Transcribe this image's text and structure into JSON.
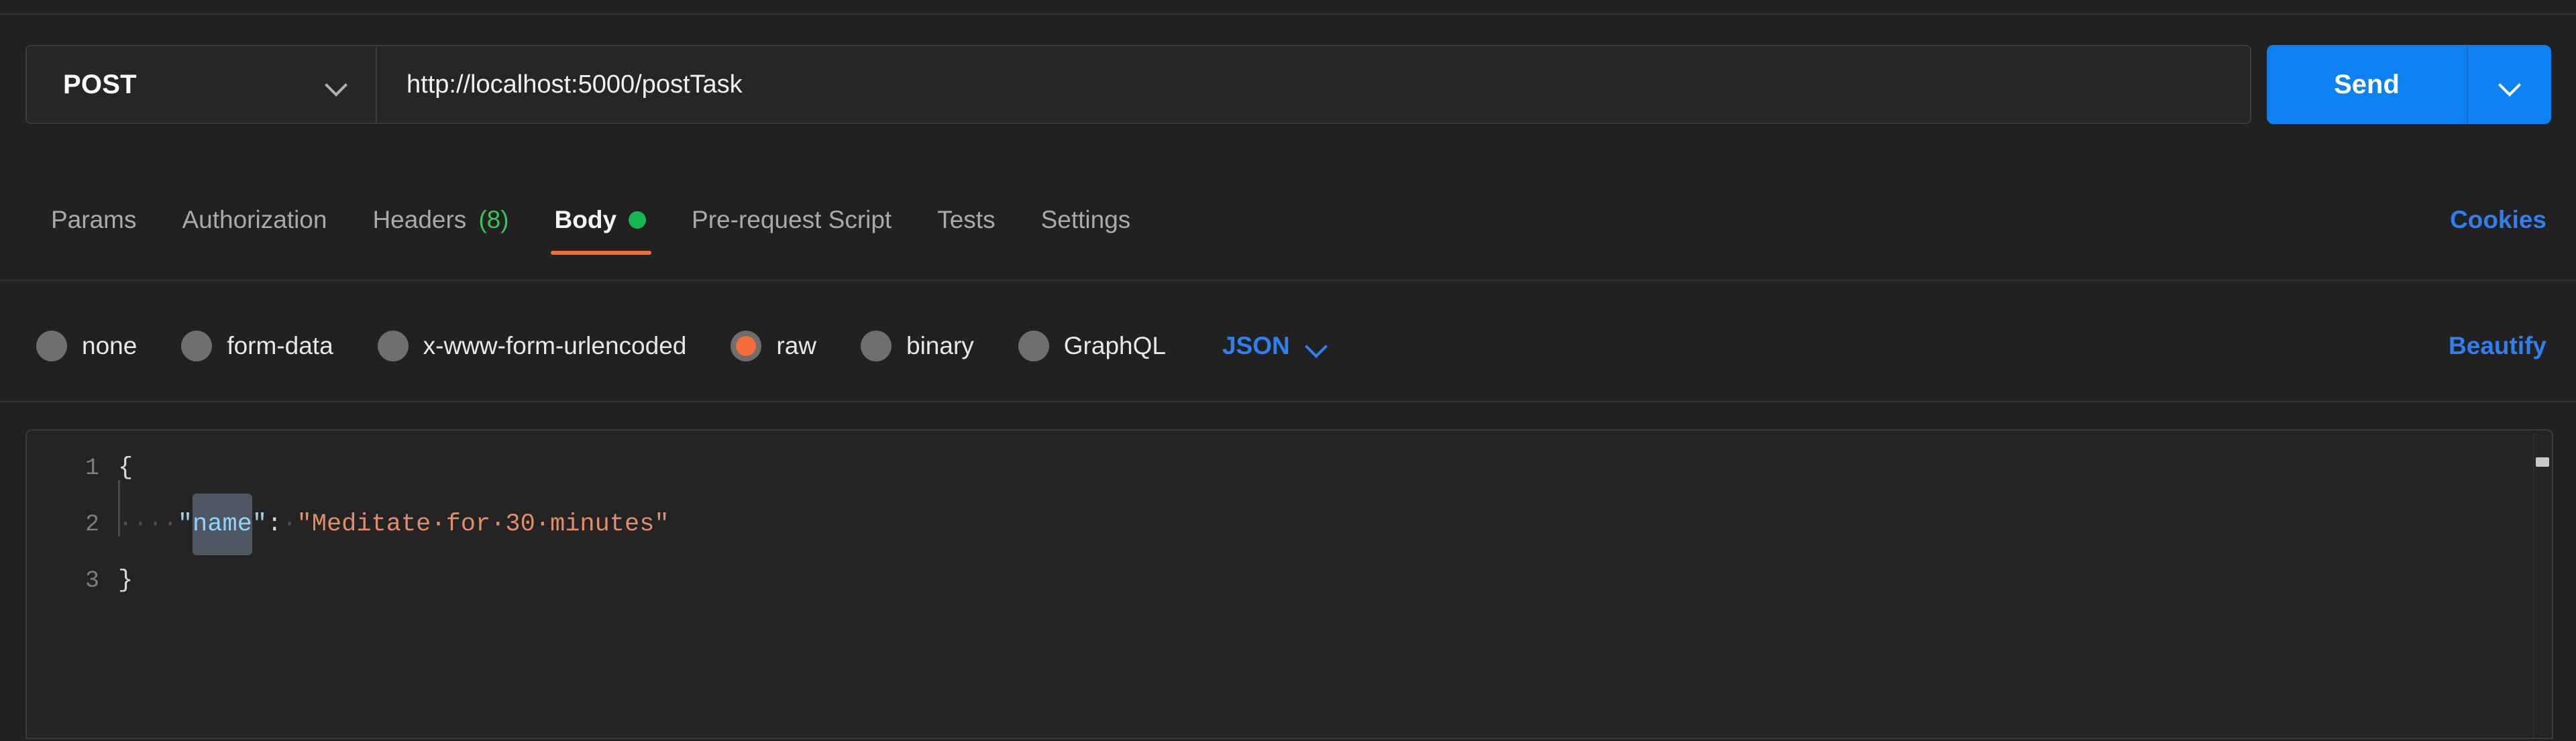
{
  "request": {
    "method": "POST",
    "url": "http://localhost:5000/postTask",
    "send_label": "Send"
  },
  "tabs": [
    {
      "label": "Params",
      "count": "",
      "dot": false,
      "active": false
    },
    {
      "label": "Authorization",
      "count": "",
      "dot": false,
      "active": false
    },
    {
      "label": "Headers",
      "count": "(8)",
      "dot": false,
      "active": false
    },
    {
      "label": "Body",
      "count": "",
      "dot": true,
      "active": true
    },
    {
      "label": "Pre-request Script",
      "count": "",
      "dot": false,
      "active": false
    },
    {
      "label": "Tests",
      "count": "",
      "dot": false,
      "active": false
    },
    {
      "label": "Settings",
      "count": "",
      "dot": false,
      "active": false
    }
  ],
  "cookies_label": "Cookies",
  "body_types": [
    {
      "label": "none",
      "selected": false
    },
    {
      "label": "form-data",
      "selected": false
    },
    {
      "label": "x-www-form-urlencoded",
      "selected": false
    },
    {
      "label": "raw",
      "selected": true
    },
    {
      "label": "binary",
      "selected": false
    },
    {
      "label": "GraphQL",
      "selected": false
    }
  ],
  "format": "JSON",
  "beautify_label": "Beautify",
  "editor": {
    "lines": [
      {
        "number": "1",
        "indent_guide": false,
        "tokens": [
          {
            "text": "{",
            "type": "punc"
          }
        ]
      },
      {
        "number": "2",
        "indent_guide": true,
        "tokens": [
          {
            "text": "····",
            "type": "ws"
          },
          {
            "text": "\"",
            "type": "quote"
          },
          {
            "text": "name",
            "type": "key-selected"
          },
          {
            "text": "\"",
            "type": "quote"
          },
          {
            "text": ":",
            "type": "punc"
          },
          {
            "text": "·",
            "type": "ws"
          },
          {
            "text": "\"Meditate·for·30·minutes\"",
            "type": "val"
          }
        ]
      },
      {
        "number": "3",
        "indent_guide": false,
        "tokens": [
          {
            "text": "}",
            "type": "punc"
          }
        ]
      }
    ],
    "raw_body": "{\n    \"name\": \"Meditate for 30 minutes\"\n}"
  },
  "colors": {
    "accent_blue": "#0d81f2",
    "link_blue": "#2f7ff0",
    "active_orange": "#f26b3a",
    "status_green": "#16b84e",
    "page_bg": "#212121",
    "editor_bg": "#232323"
  }
}
